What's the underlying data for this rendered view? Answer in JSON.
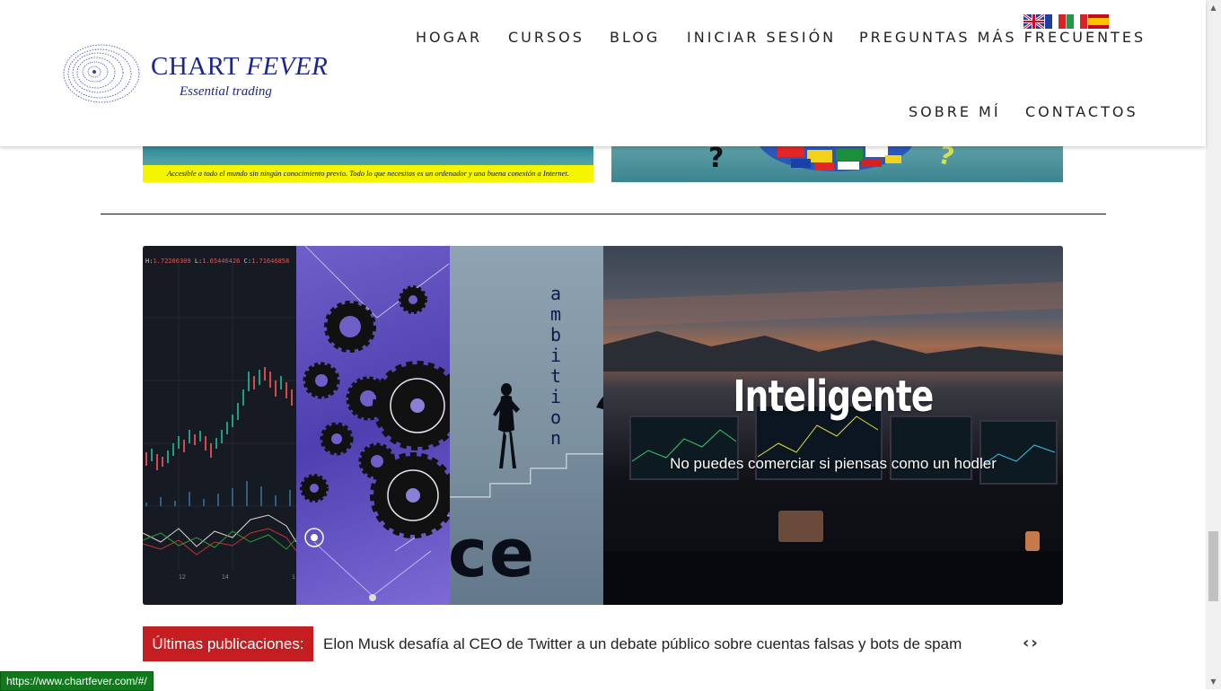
{
  "logo": {
    "title_main": "CHART ",
    "title_italic": "FEVER",
    "subtitle": "Essential trading"
  },
  "nav": {
    "items": [
      "HOGAR",
      "CURSOS",
      "BLOG",
      "INICIAR SESIÓN",
      "PREGUNTAS MÁS FRECUENTES",
      "SOBRE MÍ",
      "CONTACTOS"
    ]
  },
  "flags": [
    "english-flag-icon",
    "french-flag-icon",
    "italian-flag-icon",
    "spanish-flag-icon"
  ],
  "banners": {
    "left_caption": "Accesible a todo el mundo sin ningún conocimiento previo.  Todo lo que necesitas es un ordenador y una buena conexión a Internet.",
    "right_marks": [
      "?",
      "?"
    ]
  },
  "slider": {
    "ohlc": {
      "h_label": "H:",
      "h": "1.72206309",
      "l_label": "L:",
      "l": "1.65446426",
      "c_label": "C:",
      "c": "1.71646858"
    },
    "axis_labels": [
      "12",
      "14",
      "1"
    ],
    "ambition_word": "ambition",
    "big_text": "ce",
    "title": "Inteligente",
    "subtitle": "No puedes comerciar si piensas como un hodler"
  },
  "ticker": {
    "label": "Últimas publicaciones:",
    "headline": "Elon Musk desafía al CEO de Twitter a un debate público sobre cuentas falsas y bots de spam",
    "prev": "‹",
    "next": "›"
  },
  "status_url": "https://www.chartfever.com/#/",
  "colors": {
    "brand_blue": "#1c2690",
    "ticker_red": "#c41e22",
    "status_green": "#0e7a1c"
  }
}
